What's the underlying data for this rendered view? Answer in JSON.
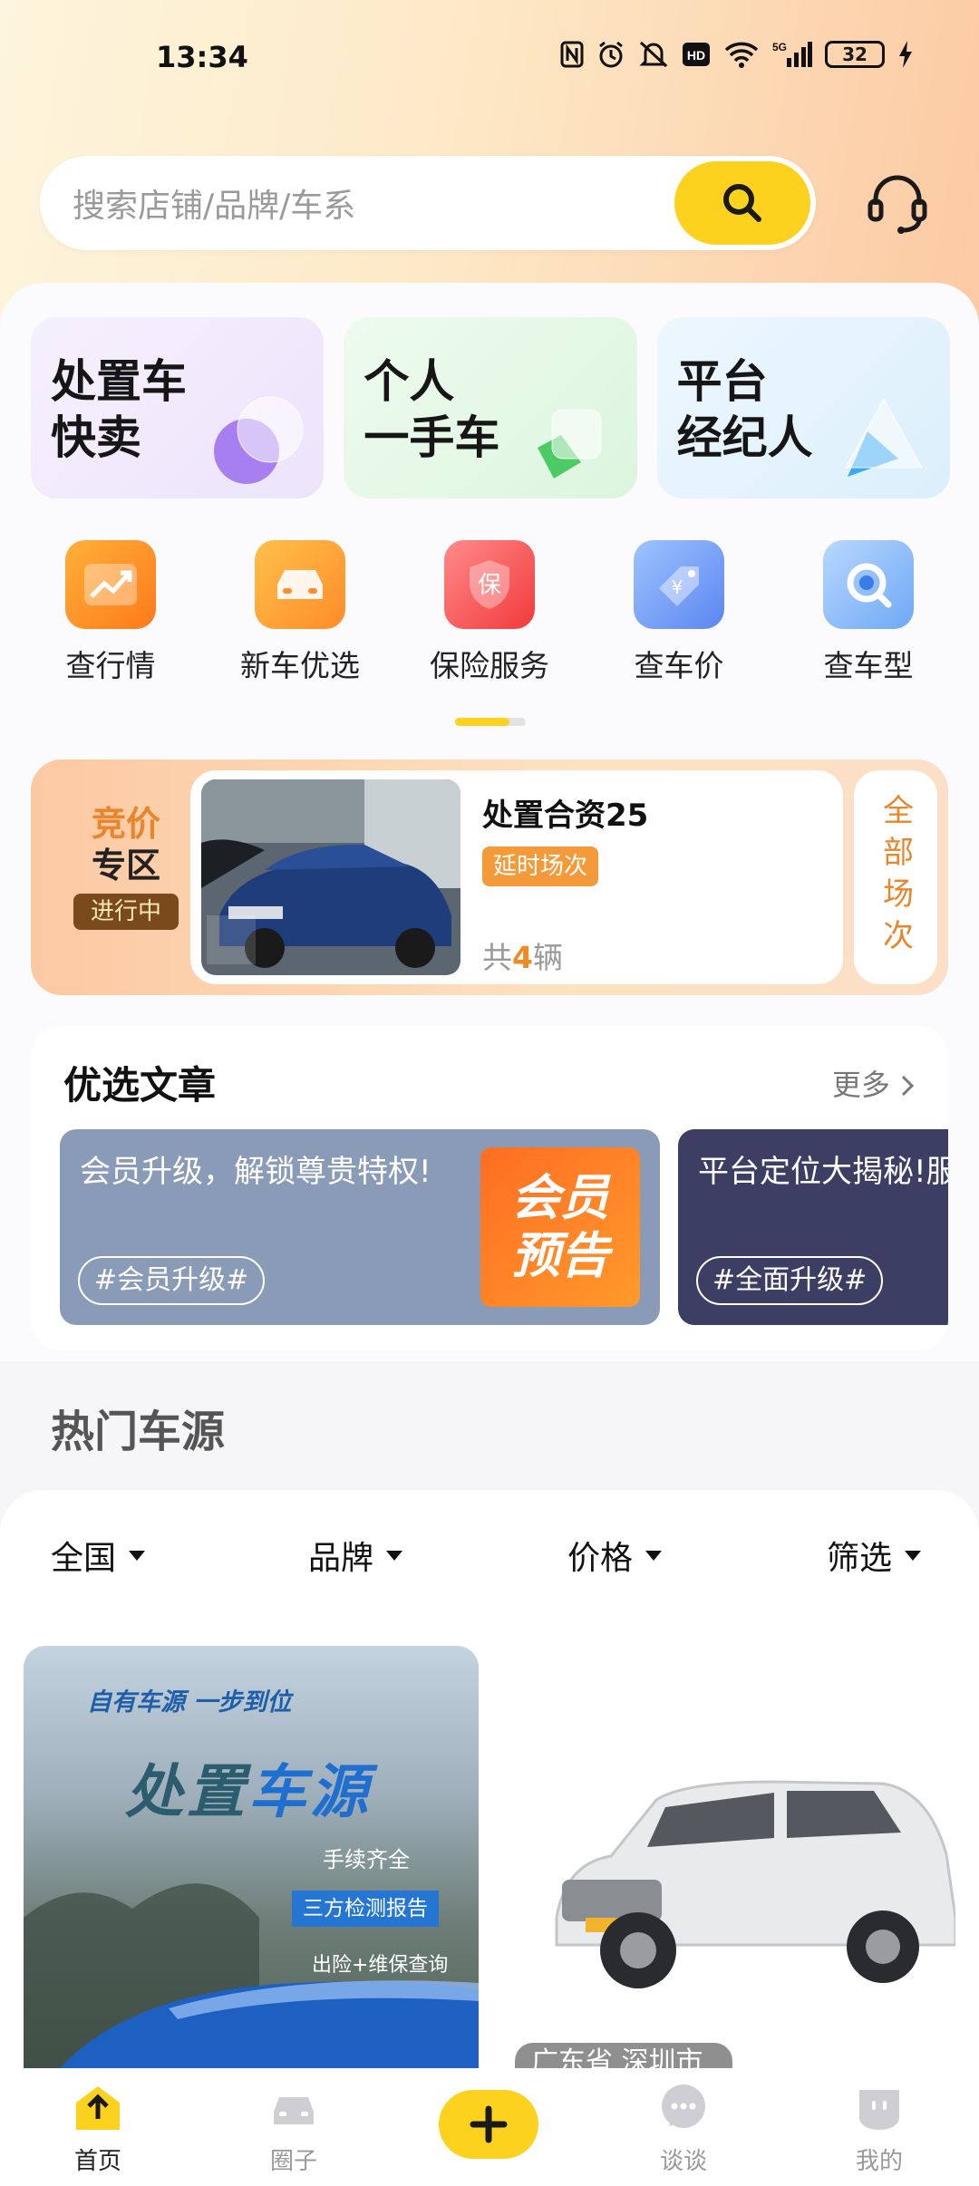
{
  "status_bar": {
    "time": "13:34",
    "battery": "32",
    "icons": [
      "nfc-icon",
      "alarm-icon",
      "mute-icon",
      "hd-icon",
      "wifi-icon",
      "5g-signal-icon",
      "battery-icon",
      "charging-icon"
    ]
  },
  "search": {
    "placeholder": "搜索店铺/品牌/车系",
    "button_icon": "search-icon",
    "service_icon": "headset-icon"
  },
  "promo_tiles": [
    {
      "line1": "处置车",
      "line2": "快卖"
    },
    {
      "line1": "个人",
      "line2": "一手车"
    },
    {
      "line1": "平台",
      "line2": "经纪人"
    }
  ],
  "quick_nav": [
    {
      "label": "查行情",
      "icon": "trend-chart-icon"
    },
    {
      "label": "新车优选",
      "icon": "car-front-icon"
    },
    {
      "label": "保险服务",
      "icon": "insurance-shield-icon"
    },
    {
      "label": "查车价",
      "icon": "price-tag-icon"
    },
    {
      "label": "查车型",
      "icon": "magnifier-icon"
    }
  ],
  "auction": {
    "title_line1": "竞价",
    "title_line2": "专区",
    "status": "进行中",
    "name": "处置合资25",
    "tag": "延时场次",
    "count_prefix": "共",
    "count": "4",
    "count_suffix": "辆",
    "all_sessions": "全部场次"
  },
  "articles": {
    "title": "优选文章",
    "more": "更多",
    "items": [
      {
        "text": "会员升级，解锁尊贵特权!",
        "tag": "#会员升级#",
        "promo_line1": "会员",
        "promo_line2": "预告"
      },
      {
        "text": "平台定位大揭秘!服务!",
        "tag": "#全面升级#"
      }
    ]
  },
  "hot_cars": {
    "title": "热门车源",
    "filters": [
      "全国",
      "品牌",
      "价格",
      "筛选"
    ],
    "card1": {
      "slogan": "自有车源 一步到位",
      "title_a": "处置",
      "title_b": "车源",
      "line1": "手续齐全",
      "line2": "三方检测报告",
      "line3": "出险+维保查询"
    },
    "card2": {
      "location": "广东省 深圳市"
    }
  },
  "bottom_nav": {
    "items": [
      {
        "label": "首页",
        "icon": "home-arrow-icon",
        "active": true
      },
      {
        "label": "圈子",
        "icon": "car-icon",
        "active": false
      },
      {
        "label": "谈谈",
        "icon": "chat-bubble-icon",
        "active": false
      },
      {
        "label": "我的",
        "icon": "profile-icon",
        "active": false
      }
    ],
    "add_icon": "plus-icon"
  },
  "colors": {
    "accent": "#fcd21e",
    "orange": "#e9852a",
    "article_1_bg": "#8a9bb8",
    "article_2_bg": "#3c3e63"
  }
}
